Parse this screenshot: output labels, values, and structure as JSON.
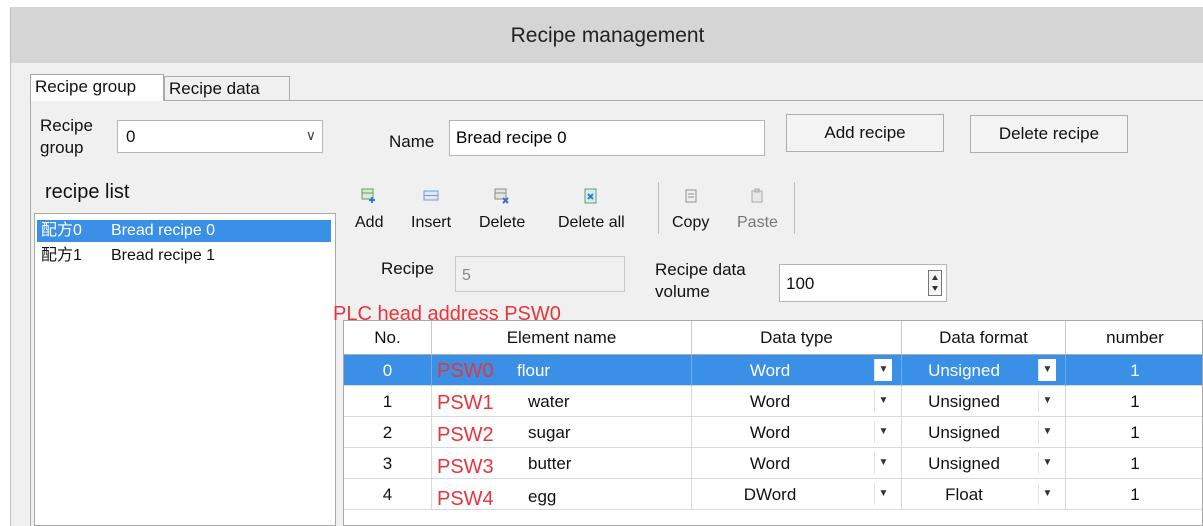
{
  "window": {
    "title": "Recipe management"
  },
  "tabs": [
    {
      "label": "Recipe group"
    },
    {
      "label": "Recipe data"
    }
  ],
  "group": {
    "label": "Recipe\ngroup",
    "value": "0"
  },
  "name_field": {
    "label": "Name",
    "value": "Bread recipe 0"
  },
  "buttons": {
    "add_recipe": "Add recipe",
    "delete_recipe": "Delete recipe"
  },
  "recipe_list": {
    "title": "recipe list",
    "items": [
      {
        "code": "配方0",
        "name": "Bread recipe 0",
        "selected": true
      },
      {
        "code": "配方1",
        "name": "Bread recipe 1",
        "selected": false
      }
    ]
  },
  "toolbar": [
    {
      "label": "Add",
      "icon": "add-row-icon",
      "enabled": true
    },
    {
      "label": "Insert",
      "icon": "insert-row-icon",
      "enabled": true
    },
    {
      "label": "Delete",
      "icon": "delete-row-icon",
      "enabled": true
    },
    {
      "label": "Delete all",
      "icon": "delete-all-icon",
      "enabled": true
    },
    {
      "label": "Copy",
      "icon": "copy-icon",
      "enabled": true
    },
    {
      "label": "Paste",
      "icon": "paste-icon",
      "enabled": false
    }
  ],
  "recipe_count": {
    "label": "Recipe",
    "value": "5"
  },
  "data_volume": {
    "label": "Recipe data\nvolume",
    "value": "100"
  },
  "plc_head_address": "PLC head address PSW0",
  "table": {
    "columns": [
      "No.",
      "Element name",
      "Data type",
      "Data format",
      "number"
    ],
    "rows": [
      {
        "no": "0",
        "address": "PSW0",
        "name": "flour",
        "type": "Word",
        "format": "Unsigned",
        "number": "1",
        "selected": true
      },
      {
        "no": "1",
        "address": "PSW1",
        "name": "water",
        "type": "Word",
        "format": "Unsigned",
        "number": "1",
        "selected": false
      },
      {
        "no": "2",
        "address": "PSW2",
        "name": "sugar",
        "type": "Word",
        "format": "Unsigned",
        "number": "1",
        "selected": false
      },
      {
        "no": "3",
        "address": "PSW3",
        "name": "butter",
        "type": "Word",
        "format": "Unsigned",
        "number": "1",
        "selected": false
      },
      {
        "no": "4",
        "address": "PSW4",
        "name": "egg",
        "type": "DWord",
        "format": "Float",
        "number": "1",
        "selected": false
      }
    ]
  },
  "colors": {
    "selection": "#3a8fe6",
    "annotation": "#e8353c",
    "titlebar": "#d5d5d5"
  }
}
